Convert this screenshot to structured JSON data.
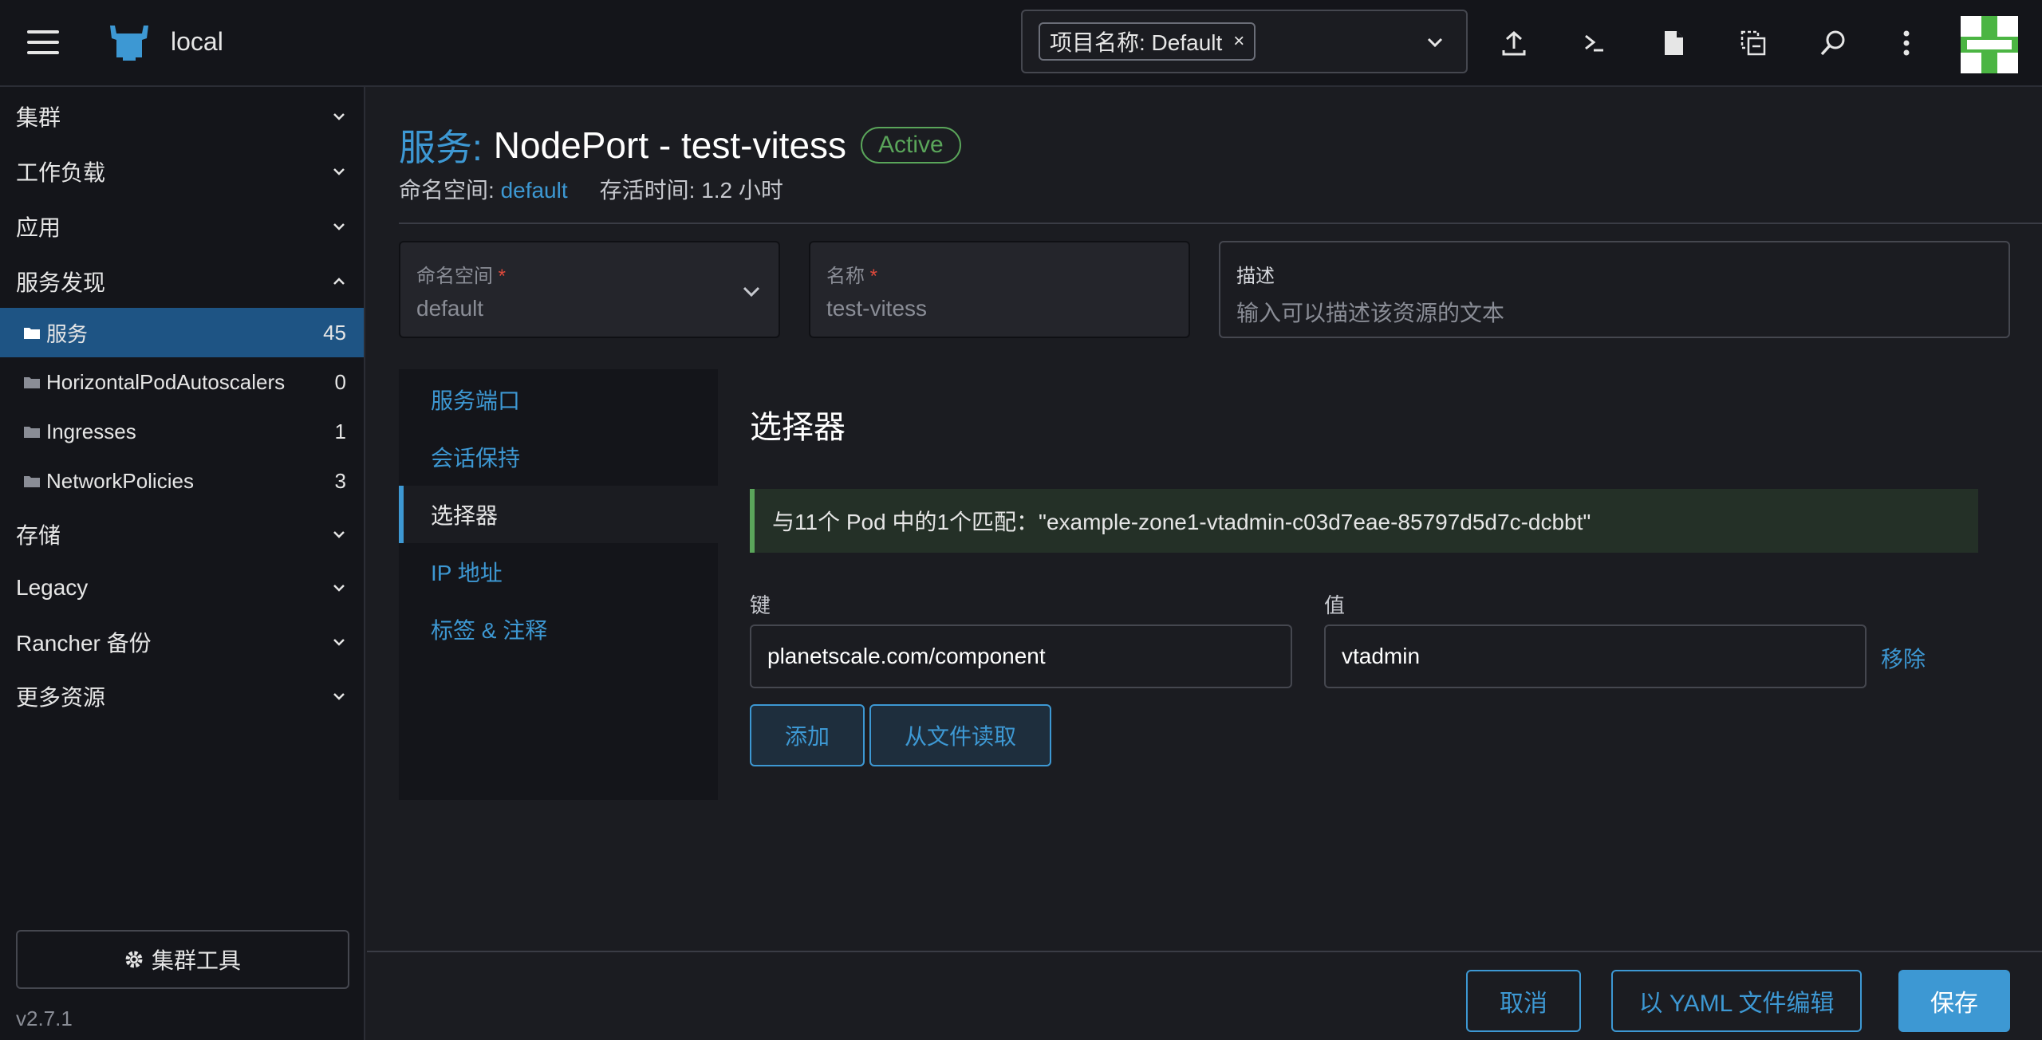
{
  "topbar": {
    "cluster_name": "local",
    "ns_chip_label": "项目名称: Default",
    "ns_chip_remove": "×"
  },
  "sidebar": {
    "groups": {
      "cluster": "集群",
      "workload": "工作负载",
      "apps": "应用",
      "service_discovery": "服务发现",
      "storage": "存储",
      "legacy": "Legacy",
      "rancher_backup": "Rancher 备份",
      "more_resources": "更多资源"
    },
    "items": [
      {
        "label": "服务",
        "count": "45"
      },
      {
        "label": "HorizontalPodAutoscalers",
        "count": "0"
      },
      {
        "label": "Ingresses",
        "count": "1"
      },
      {
        "label": "NetworkPolicies",
        "count": "3"
      }
    ],
    "cluster_tools": "集群工具",
    "version": "v2.7.1"
  },
  "header": {
    "prefix": "服务:",
    "name": "NodePort - test-vitess",
    "status": "Active",
    "namespace_label": "命名空间:",
    "namespace_value": "default",
    "age_label": "存活时间: 1.2 小时"
  },
  "form": {
    "namespace": {
      "label": "命名空间",
      "required": "*",
      "value": "default"
    },
    "name": {
      "label": "名称",
      "required": "*",
      "value": "test-vitess"
    },
    "description": {
      "label": "描述",
      "placeholder": "输入可以描述该资源的文本"
    }
  },
  "tabs": [
    "服务端口",
    "会话保持",
    "选择器",
    "IP 地址",
    "标签 & 注释"
  ],
  "selector": {
    "title": "选择器",
    "match_text": "与11个 Pod 中的1个匹配：\"example-zone1-vtadmin-c03d7eae-85797d5d7c-dcbbt\"",
    "key_label": "键",
    "value_label": "值",
    "key": "planetscale.com/component",
    "value": "vtadmin",
    "remove": "移除",
    "add": "添加",
    "read_file": "从文件读取"
  },
  "footer": {
    "cancel": "取消",
    "edit_yaml": "以 YAML 文件编辑",
    "save": "保存"
  },
  "colors": {
    "accent": "#3d98d3",
    "active_nav": "#1e5484",
    "success": "#5aa55a",
    "required": "#e04a3c"
  },
  "icons": [
    "menu-icon",
    "rancher-logo-icon",
    "chevron-down-icon",
    "upload-icon",
    "terminal-icon",
    "file-icon",
    "copy-icon",
    "search-icon",
    "more-vertical-icon",
    "folder-icon",
    "gear-icon"
  ]
}
